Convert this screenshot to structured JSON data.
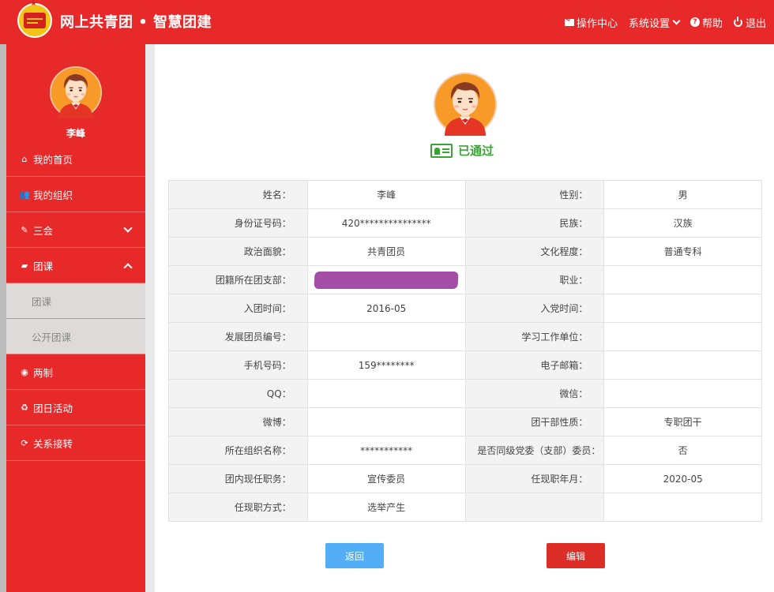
{
  "header": {
    "title": "网上共青团 • 智慧团建",
    "nav": [
      {
        "label": "操作中心",
        "icon": "envelope-icon"
      },
      {
        "label": "系统设置",
        "icon": "chevron-down-icon"
      },
      {
        "label": "帮助",
        "icon": "question-icon"
      },
      {
        "label": "退出",
        "icon": "power-icon"
      }
    ]
  },
  "sidebar": {
    "user_name": "李峰",
    "items": [
      {
        "label": "我的首页",
        "icon": "home-icon"
      },
      {
        "label": "我的组织",
        "icon": "users-icon"
      },
      {
        "label": "三会",
        "icon": "edit-icon"
      },
      {
        "label": "团课",
        "icon": "folder-open-icon"
      },
      {
        "label": "团课",
        "icon": ""
      },
      {
        "label": "公开团课",
        "icon": ""
      },
      {
        "label": "两制",
        "icon": "target-icon"
      },
      {
        "label": "团日活动",
        "icon": "recycle-icon"
      },
      {
        "label": "关系接转",
        "icon": "refresh-icon"
      }
    ]
  },
  "profile": {
    "status": "已通过",
    "status_color": "#3aa335"
  },
  "info": {
    "name_label": "姓名：",
    "name": "李峰",
    "gender_label": "性别：",
    "gender": "男",
    "id_label": "身份证号码：",
    "id": "420***************",
    "ethnic_label": "民族：",
    "ethnic": "汉族",
    "political_label": "政治面貌：",
    "political": "共青团员",
    "education_label": "文化程度：",
    "education": "普通专科",
    "branch_label": "团籍所在团支部：",
    "job_label": "职业：",
    "join_league_label": "入团时间：",
    "join_league": "2016-05",
    "join_party_label": "入党时间：",
    "member_no_label": "发展团员编号：",
    "work_unit_label": "学习工作单位：",
    "phone_label": "手机号码：",
    "phone": "159********",
    "email_label": "电子邮箱：",
    "qq_label": "QQ：",
    "wechat_label": "微信：",
    "weibo_label": "微博：",
    "cadre_type_label": "团干部性质：",
    "cadre_type": "专职团干",
    "org_name_label": "所在组织名称：",
    "org_name": "***********",
    "committee_label": "是否同级党委（支部）委员：",
    "committee": "否",
    "position_label": "团内现任职务：",
    "position": "宣传委员",
    "position_date_label": "任现职年月：",
    "position_date": "2020-05",
    "appoint_method_label": "任现职方式：",
    "appoint_method": "选举产生"
  },
  "buttons": {
    "back": "返回",
    "edit": "编辑"
  },
  "colors": {
    "brand": "#e8292a",
    "back_button": "#54aef7",
    "edit_button": "#dd2d27"
  }
}
